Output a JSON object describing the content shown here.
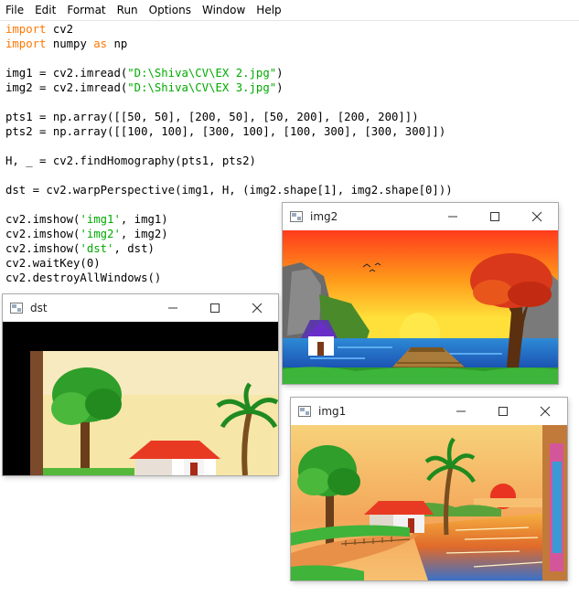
{
  "menu": [
    "File",
    "Edit",
    "Format",
    "Run",
    "Options",
    "Window",
    "Help"
  ],
  "code": {
    "line1_kw": "import",
    "line1_rest": " cv2",
    "line2_kw": "import",
    "line2_mid": " numpy ",
    "line2_as": "as",
    "line2_rest": " np",
    "line3_pre": "img1 = cv2.imread(",
    "line3_str": "\"D:\\Shiva\\CV\\EX 2.jpg\"",
    "line3_post": ")",
    "line4_pre": "img2 = cv2.imread(",
    "line4_str": "\"D:\\Shiva\\CV\\EX 3.jpg\"",
    "line4_post": ")",
    "line5": "pts1 = np.array([[50, 50], [200, 50], [50, 200], [200, 200]])",
    "line6": "pts2 = np.array([[100, 100], [300, 100], [100, 300], [300, 300]])",
    "line7": "H, _ = cv2.findHomography(pts1, pts2)",
    "line8": "dst = cv2.warpPerspective(img1, H, (img2.shape[1], img2.shape[0]))",
    "line9_pre": "cv2.imshow(",
    "line9_str": "'img1'",
    "line9_post": ", img1)",
    "line10_pre": "cv2.imshow(",
    "line10_str": "'img2'",
    "line10_post": ", img2)",
    "line11_pre": "cv2.imshow(",
    "line11_str": "'dst'",
    "line11_post": ", dst)",
    "line12": "cv2.waitKey(0)",
    "line13": "cv2.destroyAllWindows()"
  },
  "windows": {
    "img2": {
      "title": "img2"
    },
    "dst": {
      "title": "dst"
    },
    "img1": {
      "title": "img1"
    }
  },
  "colors": {
    "keyword": "#ff7700",
    "string": "#00aa00",
    "default_text": "#000000"
  }
}
